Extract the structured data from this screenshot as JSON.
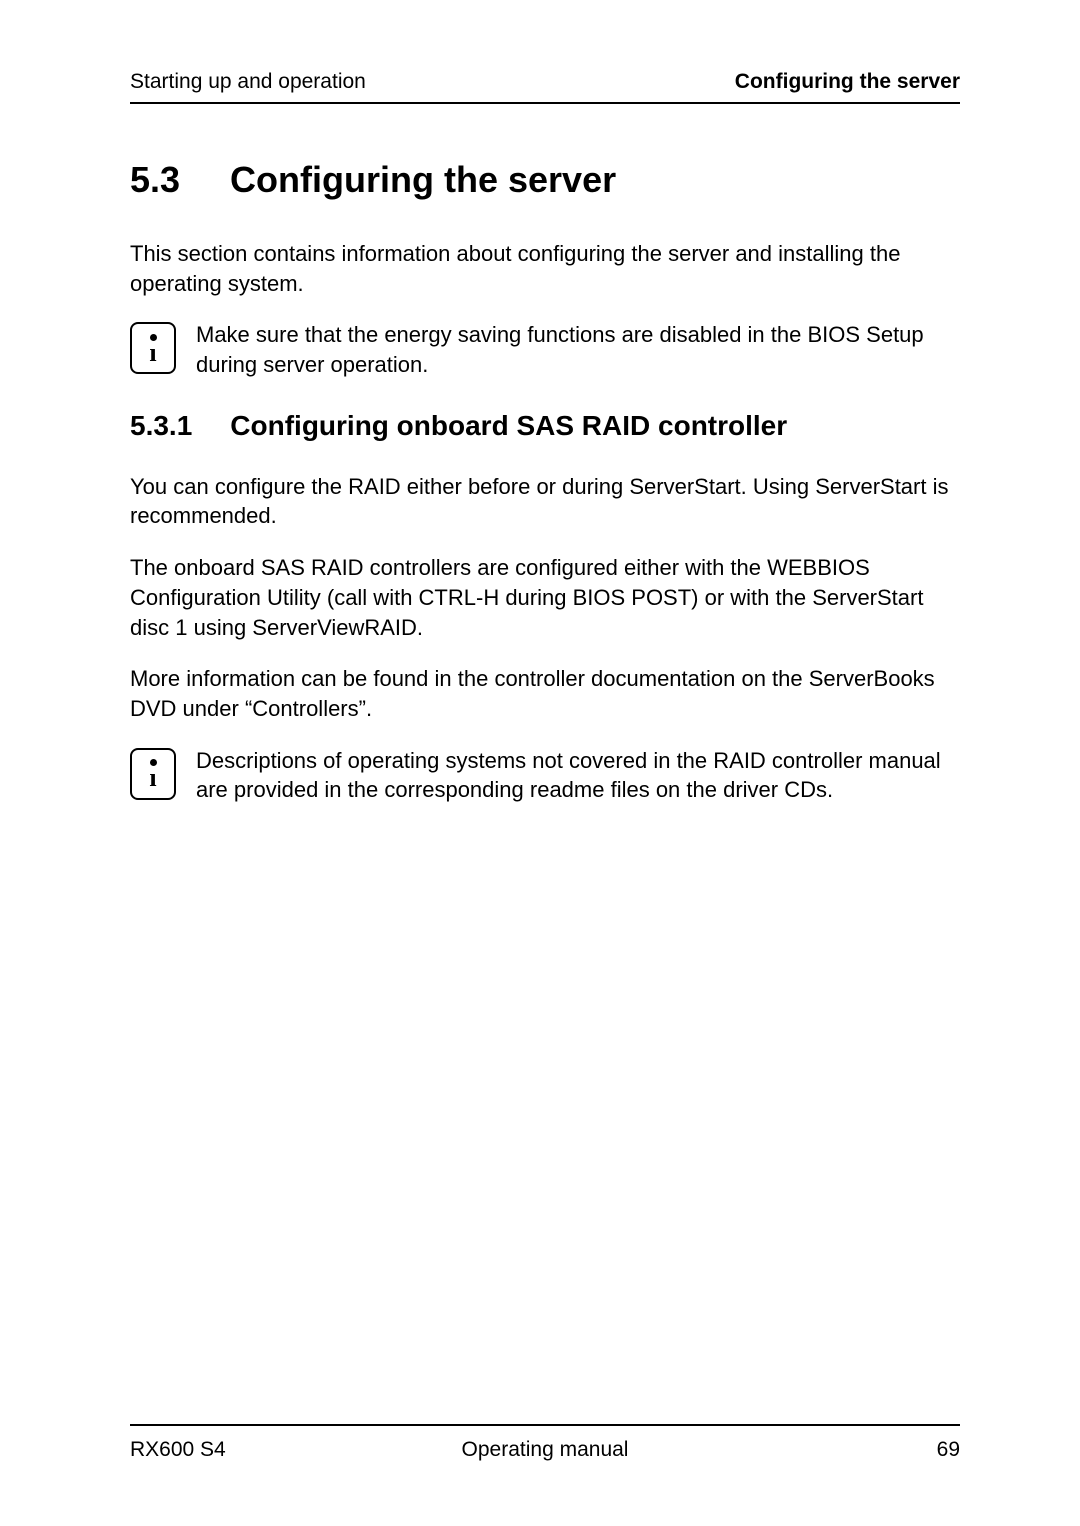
{
  "header": {
    "left": "Starting up and operation",
    "right": "Configuring the server"
  },
  "section": {
    "number": "5.3",
    "title": "Configuring the server",
    "intro": "This section contains information about configuring the server and installing the operating system.",
    "note1": "Make sure that the energy saving functions are disabled in the BIOS Setup during server operation."
  },
  "subsection": {
    "number": "5.3.1",
    "title": "Configuring onboard SAS RAID controller",
    "para1": "You can configure the RAID either before or during ServerStart. Using Server­Start is recommended.",
    "para2": "The onboard SAS RAID controllers are configured either with the WEBBIOS Configuration Utility (call with CTRL-H during BIOS POST) or with the Server­Start disc 1 using ServerViewRAID.",
    "para3": "More information can be found in the controller documentation on the Server­Books DVD under “Controllers”.",
    "note2": "Descriptions of operating systems not covered in the RAID controller manual are provided in the corresponding readme files on the driver CDs."
  },
  "footer": {
    "left": "RX600 S4",
    "center": "Operating manual",
    "right": "69"
  }
}
